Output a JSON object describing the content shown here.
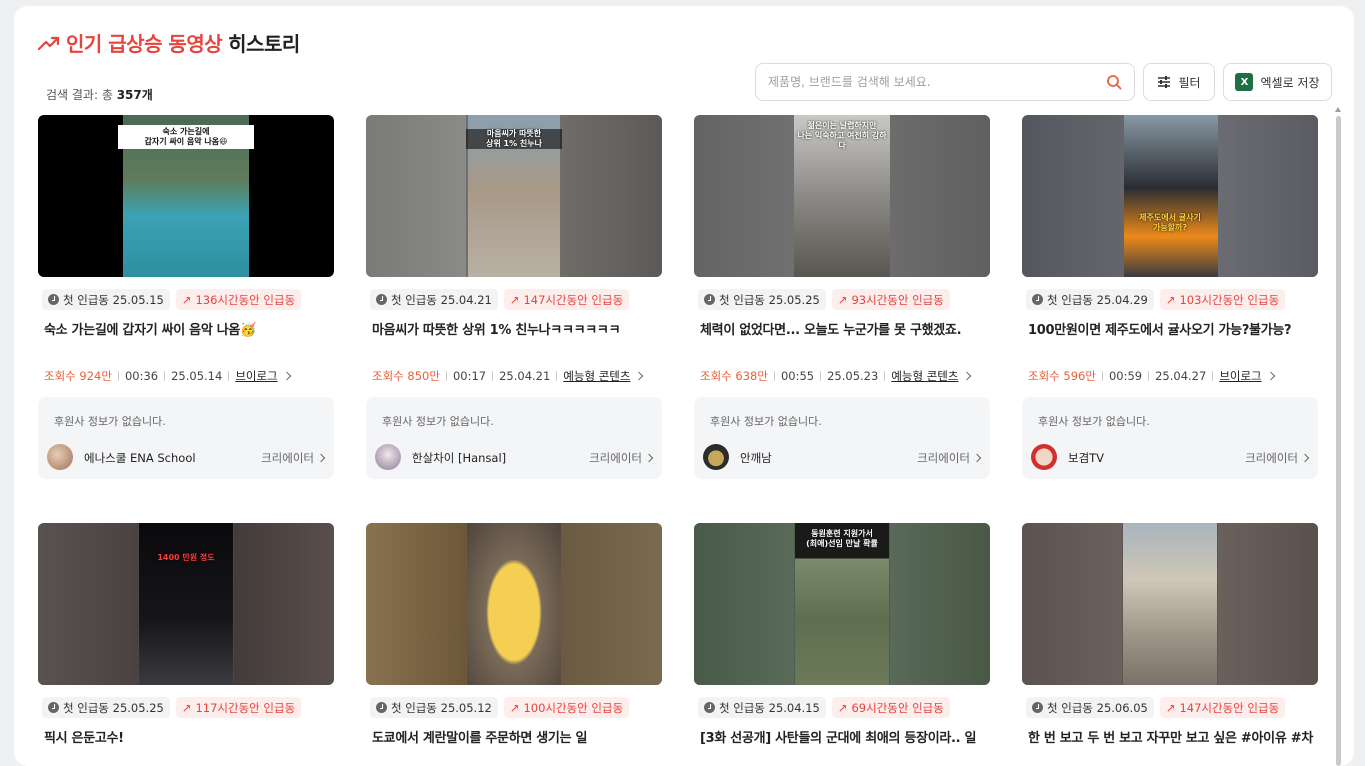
{
  "header": {
    "title_accent": "인기 급상승 동영상",
    "title_rest": "히스토리",
    "count_prefix": "검색 결과: 총",
    "count_value": "357개",
    "search_placeholder": "제품명, 브랜드를 검색해 보세요.",
    "filter_label": "필터",
    "excel_label": "엑셀로 저장",
    "excel_icon_letter": "X"
  },
  "colors": {
    "accent": "#e8433d",
    "views": "#e8603d",
    "badge_red_bg": "#fdeeee"
  },
  "cards": [
    {
      "first": "첫 인급동 25.05.15",
      "hours": "136시간동안 인급동",
      "title": "숙소 가는길에 갑자기 싸이 음악 나옴🥳",
      "views": "조회수 924만",
      "duration": "00:36",
      "date": "25.05.14",
      "category": "브이로그",
      "sponsor": "후원사 정보가 없습니다.",
      "creator": "에나스쿨 ENA School",
      "creator_link": "크리에이터",
      "thumb_caption": "숙소 가는길에\n갑자기 싸이 음악 나옴😆"
    },
    {
      "first": "첫 인급동 25.04.21",
      "hours": "147시간동안 인급동",
      "title": "마음씨가 따뜻한 상위 1% 친누나ㅋㅋㅋㅋㅋㅋ",
      "views": "조회수 850만",
      "duration": "00:17",
      "date": "25.04.21",
      "category": "예능형 콘텐츠",
      "sponsor": "후원사 정보가 없습니다.",
      "creator": "한살차이 [Hansal]",
      "creator_link": "크리에이터",
      "thumb_caption": "마음씨가 따뜻한\n상위 1% 친누나"
    },
    {
      "first": "첫 인급동 25.05.25",
      "hours": "93시간동안 인급동",
      "title": "체력이 없었다면... 오늘도 누군가를 못 구했겠죠.",
      "views": "조회수 638만",
      "duration": "00:55",
      "date": "25.05.23",
      "category": "예능형 콘텐츠",
      "sponsor": "후원사 정보가 없습니다.",
      "creator": "안깨남",
      "creator_link": "크리에이터",
      "thumb_caption": "젊은이는 날렵하지만\n나는 익숙하고 여전히 강하다"
    },
    {
      "first": "첫 인급동 25.04.29",
      "hours": "103시간동안 인급동",
      "title": "100만원이면 제주도에서 귤사오기 가능?불가능?",
      "views": "조회수 596만",
      "duration": "00:59",
      "date": "25.04.27",
      "category": "브이로그",
      "sponsor": "후원사 정보가 없습니다.",
      "creator": "보겸TV",
      "creator_link": "크리에이터",
      "thumb_caption": "제주도에서 귤사기\n가능할까?"
    },
    {
      "first": "첫 인급동 25.05.25",
      "hours": "117시간동안 인급동",
      "title": "픽시 은둔고수!",
      "thumb_caption": "1400 만원 정도"
    },
    {
      "first": "첫 인급동 25.05.12",
      "hours": "100시간동안 인급동",
      "title": "도쿄에서 계란말이를 주문하면 생기는 일",
      "thumb_caption": ""
    },
    {
      "first": "첫 인급동 25.04.15",
      "hours": "69시간동안 인급동",
      "title": "[3화 선공개] 사탄들의 군대에 최애의 등장이라.. 일",
      "thumb_caption": "동원훈련 지원가서\n(최애)선임 만날 확률"
    },
    {
      "first": "첫 인급동 25.06.05",
      "hours": "147시간동안 인급동",
      "title": "한 번 보고 두 번 보고 자꾸만 보고 싶은 #아이유 #차",
      "thumb_caption": ""
    }
  ]
}
